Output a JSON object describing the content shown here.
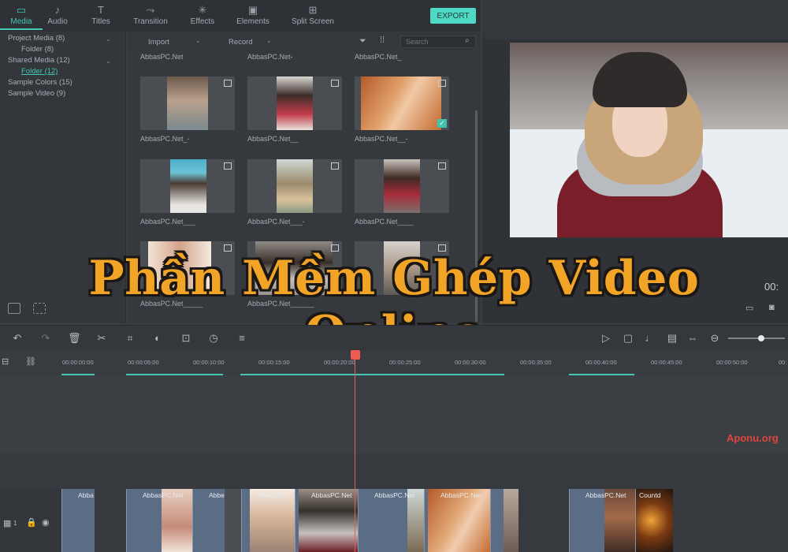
{
  "nav": {
    "tabs": [
      {
        "label": "Media",
        "icon": "folder-icon",
        "glyph": "▭"
      },
      {
        "label": "Audio",
        "icon": "music-note-icon",
        "glyph": "♪"
      },
      {
        "label": "Titles",
        "icon": "text-t-icon",
        "glyph": "T"
      },
      {
        "label": "Transition",
        "icon": "transition-icon",
        "glyph": "⤳"
      },
      {
        "label": "Effects",
        "icon": "effects-sparkle-icon",
        "glyph": "✳"
      },
      {
        "label": "Elements",
        "icon": "image-element-icon",
        "glyph": "▣"
      },
      {
        "label": "Split Screen",
        "icon": "split-screen-icon",
        "glyph": "⊞"
      }
    ],
    "active_tab": "Media",
    "export_label": "EXPORT"
  },
  "tree": {
    "items": [
      {
        "label": "Project Media (8)",
        "expanded": true
      },
      {
        "label": "Folder (8)"
      },
      {
        "label": "Shared Media (12)",
        "expanded": true
      },
      {
        "label": "Folder (12)",
        "active": true
      },
      {
        "label": "Sample Colors (15)"
      },
      {
        "label": "Sample Video (9)"
      }
    ]
  },
  "media_toolbar": {
    "import_label": "Import",
    "record_label": "Record",
    "search_placeholder": "Search"
  },
  "media": {
    "top_labels": [
      "AbbasPC.Net",
      "AbbasPC.Net-",
      "AbbasPC.Net_"
    ],
    "items": [
      {
        "label": "AbbasPC.Net_-",
        "checked": false
      },
      {
        "label": "AbbasPC.Net__",
        "checked": false
      },
      {
        "label": "AbbasPC.Net__-",
        "checked": true
      },
      {
        "label": "AbbasPC.Net___",
        "checked": false
      },
      {
        "label": "AbbasPC.Net___-",
        "checked": false
      },
      {
        "label": "AbbasPC.Net____",
        "checked": false
      },
      {
        "label": "AbbasPC.Net_____",
        "checked": false
      },
      {
        "label": "AbbasPC.Net______",
        "checked": false
      },
      {
        "label": "",
        "checked": true
      }
    ]
  },
  "preview": {
    "time": "00:"
  },
  "banner": {
    "title": "Phần Mềm Ghép Video Online"
  },
  "edit_toolbar": {
    "left_icons": [
      "undo-icon",
      "redo-icon",
      "delete-icon",
      "cut-icon",
      "crop-icon",
      "color-icon",
      "mosaic-icon",
      "speed-icon",
      "audio-adjust-icon"
    ],
    "right_icons": [
      "render-icon",
      "marker-icon",
      "microphone-icon",
      "voiceover-icon",
      "fit-icon",
      "zoom-out-icon"
    ],
    "zoom_level": 0.6
  },
  "timeline": {
    "ticks": [
      "00:00:00:00",
      "00:00:05:00",
      "00:00:10:00",
      "00:00:15:00",
      "00:00:20:00",
      "00:00:25:00",
      "00:00:30:00",
      "00:00:35:00",
      "00:00:40:00",
      "00:00:45:00",
      "00:00:50:00",
      "00:"
    ],
    "track_number": "1",
    "clips": [
      {
        "label": "Abba"
      },
      {
        "label": "AbbasPC.Net"
      },
      {
        "label": "Abbe"
      },
      {
        "label": "AbbasPC"
      },
      {
        "label": "AbbasPC.Net"
      },
      {
        "label": "AbbasPC.Net"
      },
      {
        "label": "AbbasPC.Net"
      },
      {
        "label": "AbbasPC.Net"
      },
      {
        "label": "Countd"
      }
    ],
    "watermark": "Aponu.org"
  },
  "colors": {
    "accent": "#44c7b3",
    "export_bg": "#4fd8c3",
    "banner_text": "#f2a426",
    "playhead": "#f05a52",
    "clip": "#5b6d85"
  }
}
